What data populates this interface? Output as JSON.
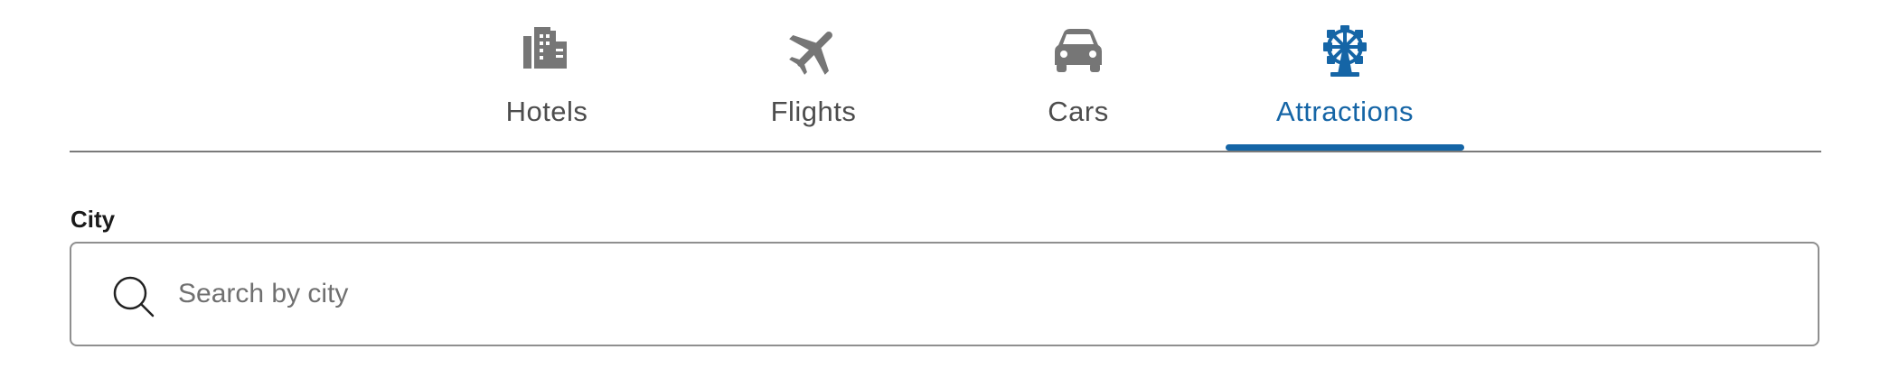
{
  "colors": {
    "accent": "#1565a6",
    "tab_text": "#4d4d4d",
    "icon_gray": "#767676"
  },
  "tabs": [
    {
      "label": "Hotels",
      "icon": "hotel-building-icon",
      "active": false
    },
    {
      "label": "Flights",
      "icon": "airplane-icon",
      "active": false
    },
    {
      "label": "Cars",
      "icon": "car-icon",
      "active": false
    },
    {
      "label": "Attractions",
      "icon": "ferris-wheel-icon",
      "active": true
    }
  ],
  "search": {
    "label": "City",
    "placeholder": "Search by city",
    "value": "",
    "icon": "search-icon"
  }
}
